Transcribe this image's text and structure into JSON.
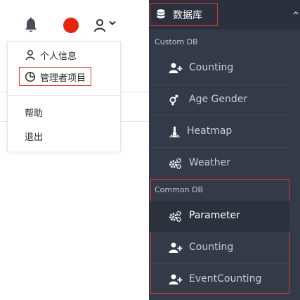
{
  "header": {
    "icons": [
      "bell-icon",
      "user-icon",
      "chevron-down-icon"
    ],
    "avatar_color": "#e4260f"
  },
  "user_menu": {
    "items": [
      {
        "label": "个人信息",
        "icon": "user-icon"
      },
      {
        "label": "管理者项目",
        "icon": "pie-chart-icon",
        "highlighted": true
      },
      {
        "label": "帮助"
      },
      {
        "label": "退出"
      }
    ]
  },
  "sidebar": {
    "header": {
      "title": "数据库",
      "icon": "database-icon"
    },
    "sections": [
      {
        "label": "Custom DB",
        "items": [
          {
            "label": "Counting",
            "icon": "user-plus-icon"
          },
          {
            "label": "Age Gender",
            "icon": "gender-icon"
          },
          {
            "label": "Heatmap",
            "icon": "heat-icon"
          },
          {
            "label": "Weather",
            "icon": "cogs-icon"
          }
        ]
      },
      {
        "label": "Common DB",
        "items": [
          {
            "label": "Parameter",
            "icon": "cogs-icon",
            "active": true
          },
          {
            "label": "Counting",
            "icon": "user-plus-icon"
          },
          {
            "label": "EventCounting",
            "icon": "user-plus-icon"
          }
        ]
      }
    ],
    "colors": {
      "background": "#343a48",
      "highlight_border": "#d63b3b"
    }
  }
}
